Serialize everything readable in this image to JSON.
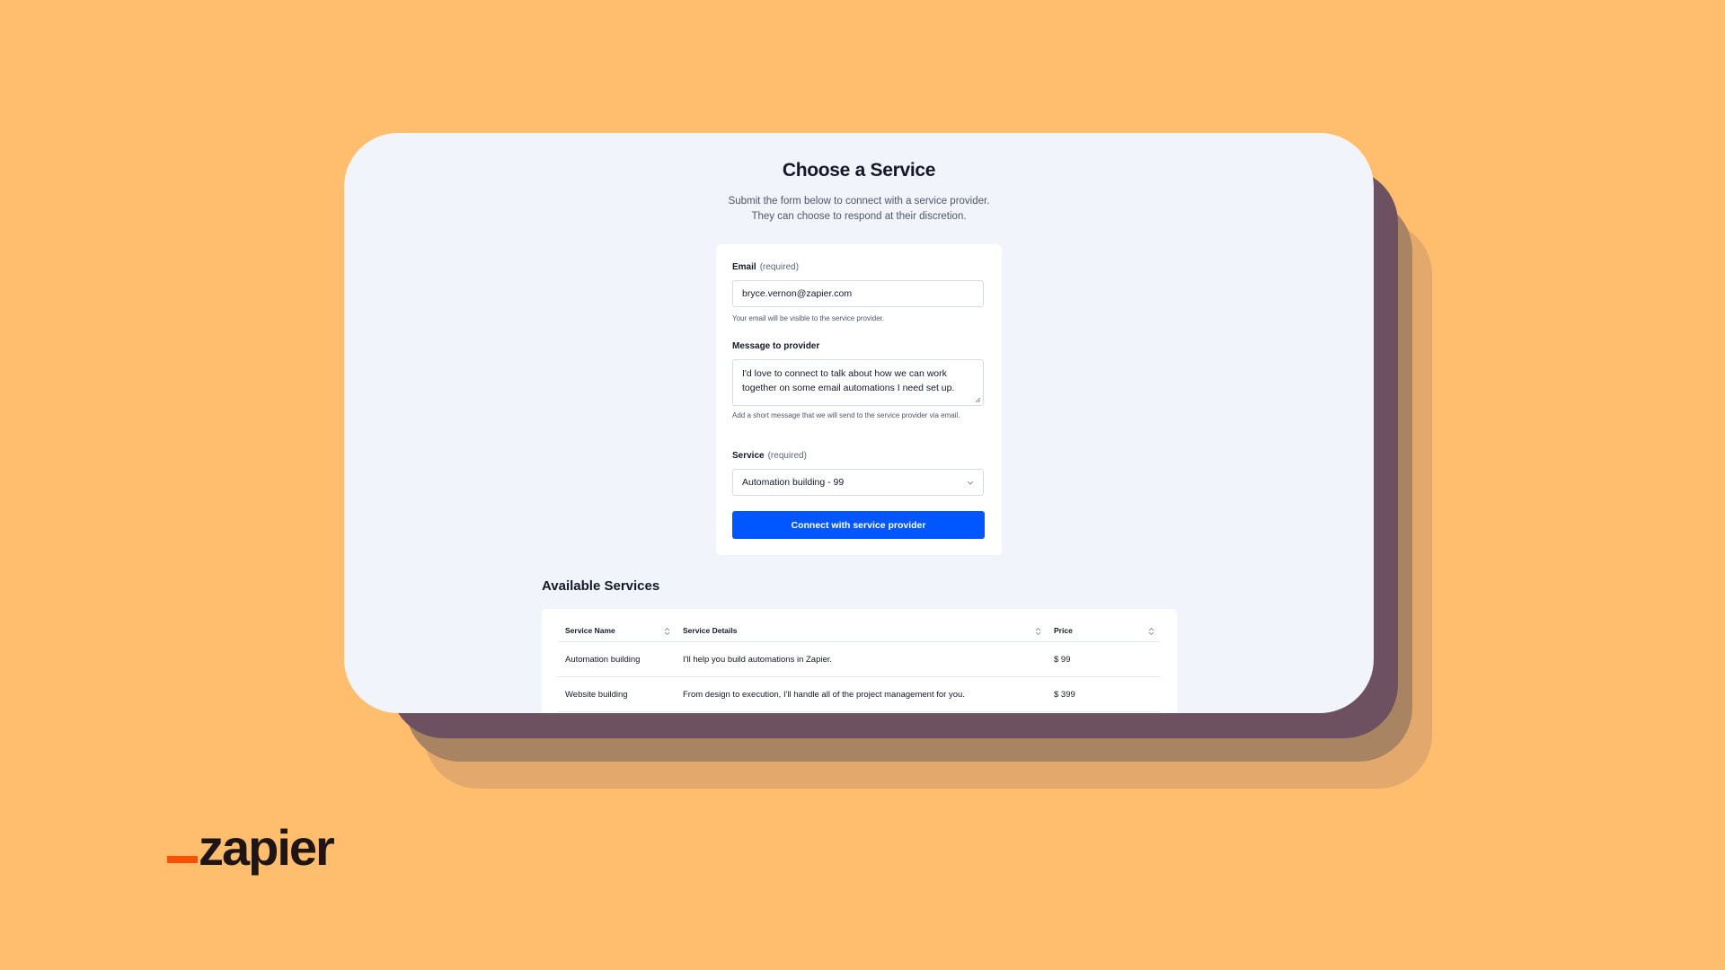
{
  "page": {
    "title": "Choose a Service",
    "subtitle_line1": "Submit the form below to connect with a service provider.",
    "subtitle_line2": "They can choose to respond at their discretion."
  },
  "form": {
    "email_label": "Email",
    "email_required": "(required)",
    "email_value": "bryce.vernon@zapier.com",
    "email_help": "Your email will be visible to the service provider.",
    "message_label": "Message to provider",
    "message_value": "I'd love to connect to talk about how we can work together on some email automations I need set up.",
    "message_help": "Add a short message that we will send to the service provider via email.",
    "service_label": "Service",
    "service_required": "(required)",
    "service_selected": "Automation building - 99",
    "submit_label": "Connect with service provider"
  },
  "services": {
    "title": "Available Services",
    "columns": [
      "Service Name",
      "Service Details",
      "Price"
    ],
    "rows": [
      {
        "name": "Automation building",
        "details": "I'll help you build automations in Zapier.",
        "price": "$ 99"
      },
      {
        "name": "Website building",
        "details": "From design to execution, I'll handle all of the project management for you.",
        "price": "$ 399"
      }
    ]
  },
  "brand": {
    "logo_text": "zapier",
    "accent_color": "#FF4F00",
    "button_color": "#0057FF",
    "background_color": "#FFBE6E"
  },
  "icons": {
    "select": "chevron-down-icon",
    "sort": "sort-icon",
    "resize": "resize-grip-icon"
  }
}
